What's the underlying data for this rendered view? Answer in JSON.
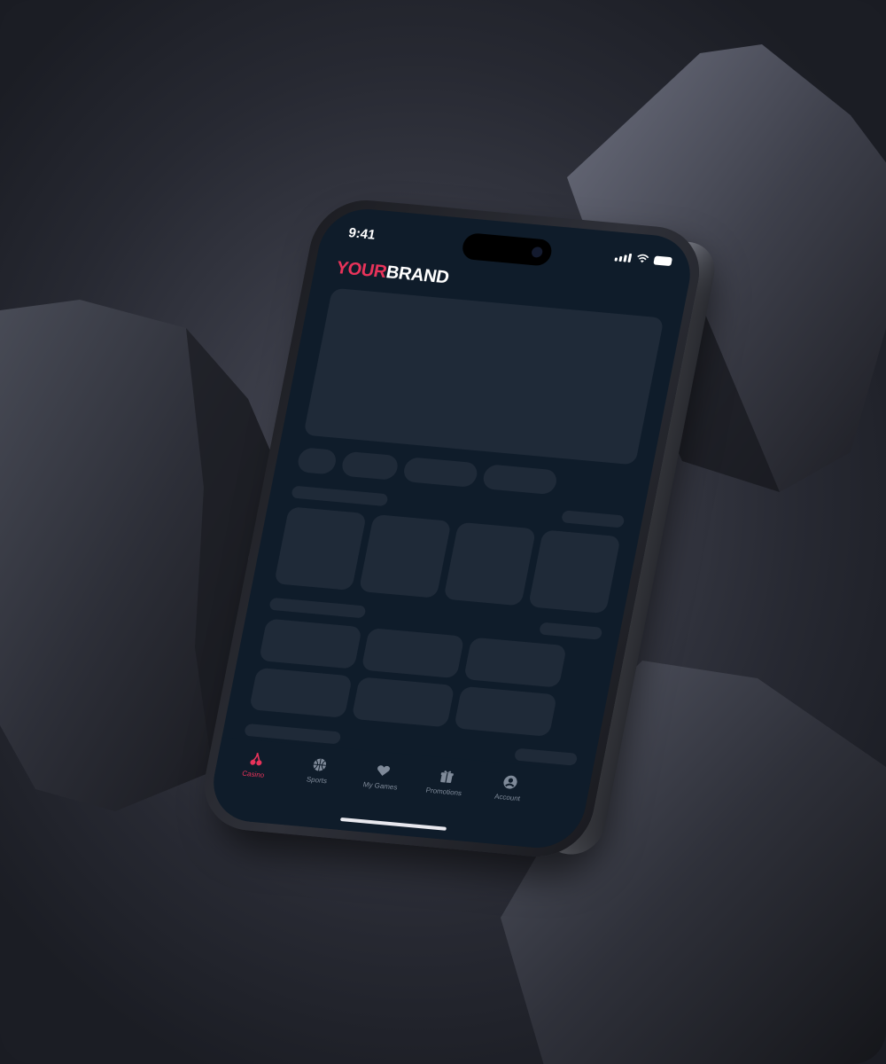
{
  "status_bar": {
    "time": "9:41"
  },
  "brand": {
    "part1": "YOUR",
    "part2": "BRAND",
    "accent_color": "#e8335a"
  },
  "tabbar": {
    "items": [
      {
        "label": "Casino",
        "icon": "cherry-icon",
        "active": true
      },
      {
        "label": "Sports",
        "icon": "basketball-icon",
        "active": false
      },
      {
        "label": "My Games",
        "icon": "heart-icon",
        "active": false
      },
      {
        "label": "Promotions",
        "icon": "gift-icon",
        "active": false
      },
      {
        "label": "Account",
        "icon": "user-icon",
        "active": false
      }
    ]
  }
}
